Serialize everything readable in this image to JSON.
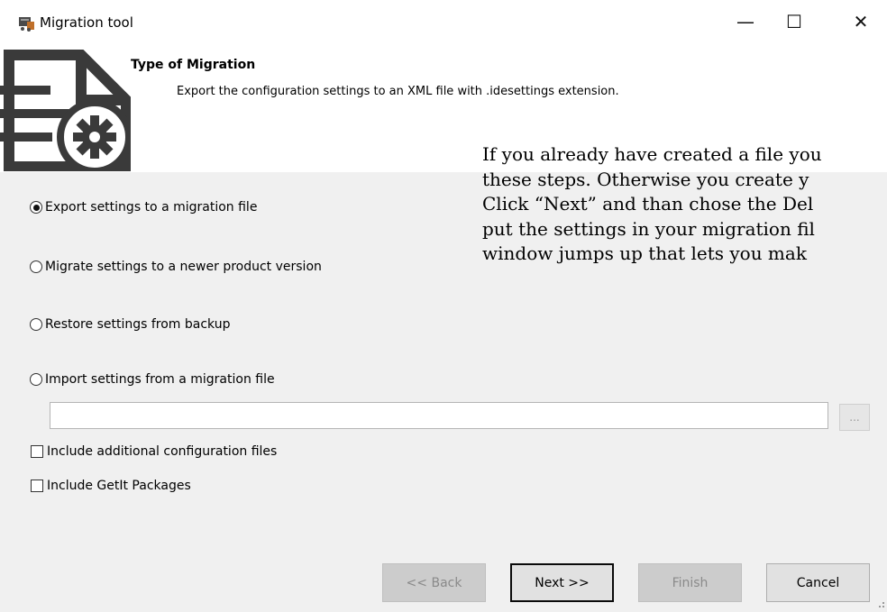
{
  "window": {
    "title": "Migration tool",
    "controls": {
      "minimize": "—",
      "maximize": "☐",
      "close": "✕"
    }
  },
  "header": {
    "title": "Type of Migration",
    "description": "Export the configuration settings to an XML file with .idesettings extension."
  },
  "overlay": {
    "lines": [
      "If you already have created a file you",
      "these steps. Otherwise you create y",
      "Click “Next” and than chose the Del",
      "put the settings in your migration fil",
      "window jumps up that lets you mak"
    ]
  },
  "options": [
    {
      "label": "Export settings to a migration file",
      "selected": true
    },
    {
      "label": "Migrate settings to a newer product version",
      "selected": false
    },
    {
      "label": "Restore settings from backup",
      "selected": false
    },
    {
      "label": "Import settings from a migration file",
      "selected": false
    }
  ],
  "file_input": {
    "value": "",
    "browse_label": "..."
  },
  "checkboxes": [
    {
      "label": "Include additional configuration files",
      "checked": false
    },
    {
      "label": "Include GetIt Packages",
      "checked": false
    }
  ],
  "buttons": {
    "back": "<< Back",
    "next": "Next >>",
    "finish": "Finish",
    "cancel": "Cancel"
  },
  "colors": {
    "background": "#f0f0f0",
    "header_bg": "#ffffff",
    "icon_dark": "#3a3a3a",
    "icon_accent": "#c0702a"
  }
}
